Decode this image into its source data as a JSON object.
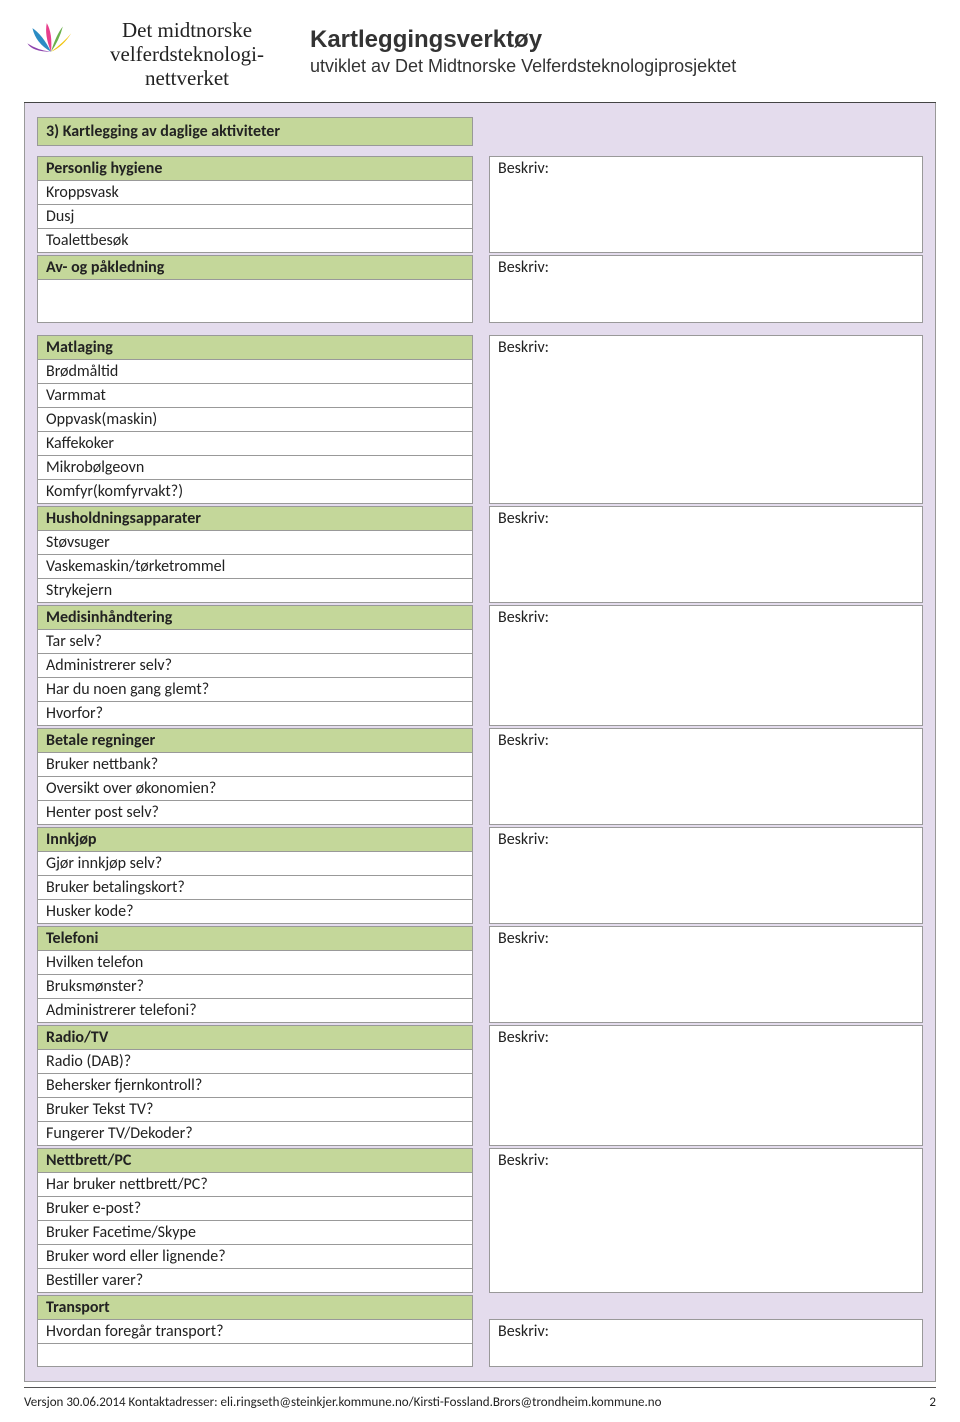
{
  "header": {
    "org_line1": "Det midtnorske",
    "org_line2": "velferdsteknologi-",
    "org_line3": "nettverket",
    "title": "Kartleggingsverktøy",
    "subtitle": "utviklet av Det Midtnorske Velferdsteknologiprosjektet"
  },
  "main_section": "3)  Kartlegging av daglige aktiviteter",
  "beskriv_label": "Beskriv:",
  "groups": {
    "hygiene": {
      "title": "Personlig hygiene",
      "items": [
        "Kroppsvask",
        "Dusj",
        "Toalettbesøk"
      ]
    },
    "dressing": {
      "title": "Av- og påkledning"
    },
    "cooking": {
      "title": "Matlaging",
      "items": [
        "Brødmåltid",
        "Varmmat",
        "Oppvask(maskin)",
        "Kaffekoker",
        "Mikrobølgeovn",
        "Komfyr(komfyrvakt?)"
      ]
    },
    "appliances": {
      "title": "Husholdningsapparater",
      "items": [
        "Støvsuger",
        "Vaskemaskin/tørketrommel",
        "Strykejern"
      ]
    },
    "medicine": {
      "title": "Medisinhåndtering",
      "items": [
        "Tar selv?",
        "Administrerer selv?",
        "Har du noen gang glemt?",
        "Hvorfor?"
      ]
    },
    "bills": {
      "title": "Betale regninger",
      "items": [
        "Bruker nettbank?",
        "Oversikt over økonomien?",
        "Henter post selv?"
      ]
    },
    "shopping": {
      "title": "Innkjøp",
      "items": [
        "Gjør innkjøp selv?",
        "Bruker betalingskort?",
        "Husker kode?"
      ]
    },
    "phone": {
      "title": "Telefoni",
      "items": [
        "Hvilken telefon",
        "Bruksmønster?",
        "Administrerer telefoni?"
      ]
    },
    "radio": {
      "title": "Radio/TV",
      "items": [
        "Radio (DAB)?",
        "Behersker fjernkontroll?",
        "Bruker Tekst TV?",
        "Fungerer TV/Dekoder?"
      ]
    },
    "tablet": {
      "title": "Nettbrett/PC",
      "items": [
        "Har bruker nettbrett/PC?",
        "Bruker e-post?",
        "Bruker Facetime/Skype",
        "Bruker word eller lignende?",
        "Bestiller varer?"
      ]
    },
    "transport": {
      "title": "Transport",
      "items": [
        "Hvordan foregår transport?"
      ]
    }
  },
  "footer": {
    "version": "Versjon 30.06.2014 Kontaktadresser: eli.ringseth@steinkjer.kommune.no/Kirsti-Fossland.Brors@trondheim.kommune.no",
    "page": "2"
  }
}
